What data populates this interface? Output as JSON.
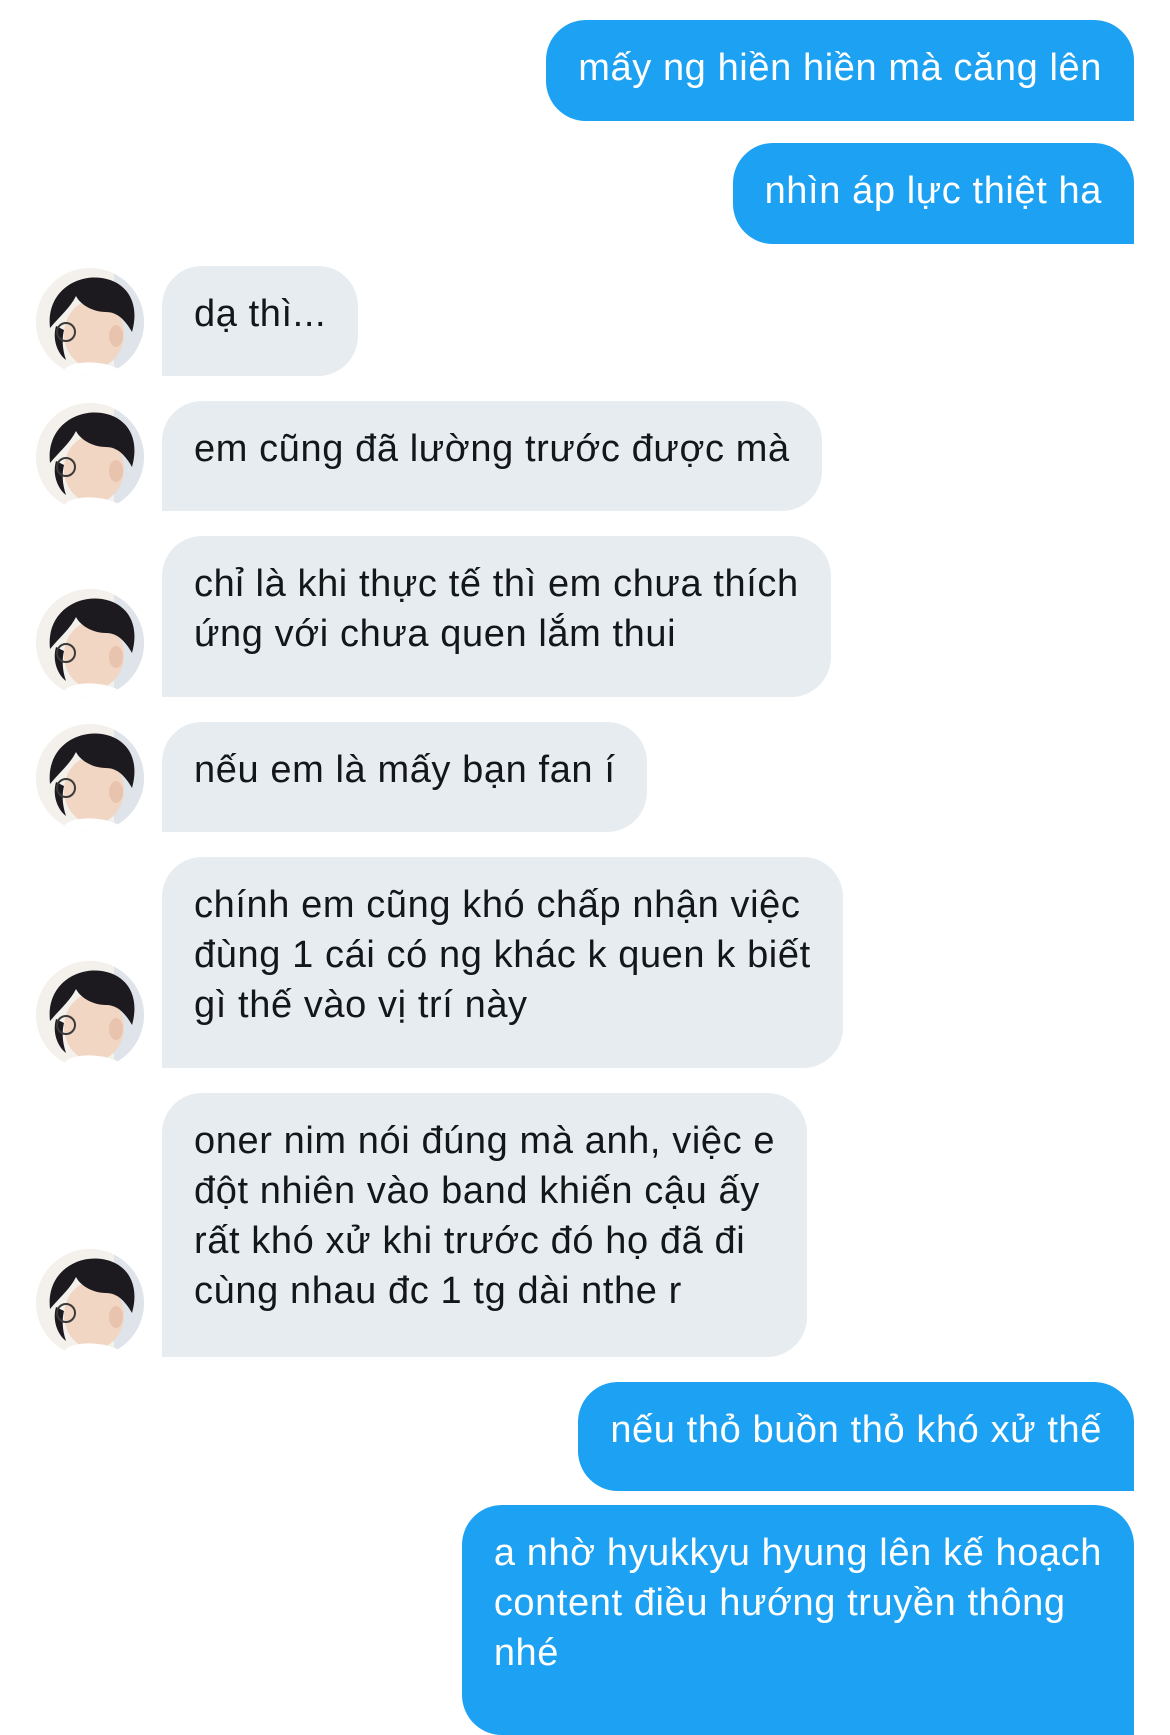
{
  "conversation": {
    "messages": [
      {
        "sender": "me",
        "text": "mấy ng hiền hiền mà căng lên"
      },
      {
        "sender": "me",
        "text": "nhìn áp lực thiệt ha"
      },
      {
        "sender": "them",
        "text": "dạ thì..."
      },
      {
        "sender": "them",
        "text": "em cũng đã lường trước được mà"
      },
      {
        "sender": "them",
        "text": "chỉ là khi thực tế thì em chưa thích\nứng với chưa quen lắm thui"
      },
      {
        "sender": "them",
        "text": "nếu em là mấy bạn fan í"
      },
      {
        "sender": "them",
        "text": "chính em cũng khó chấp nhận việc\nđùng 1 cái có ng khác k quen k biết\ngì thế vào vị trí này"
      },
      {
        "sender": "them",
        "text": "oner nim nói đúng mà anh, việc e\nđột nhiên vào band khiến cậu ấy\nrất khó xử khi trước đó họ đã đi\ncùng nhau đc 1 tg dài nthe r"
      },
      {
        "sender": "me",
        "text": "nếu thỏ buồn thỏ khó xử thế"
      },
      {
        "sender": "me",
        "text": "a nhờ hyukkyu hyung lên kế hoạch\ncontent điều hướng truyền thông\nnhé"
      }
    ]
  },
  "colors": {
    "outgoing_bubble": "#1da1f2",
    "incoming_bubble": "#e6ecf0",
    "incoming_text": "#14171a",
    "outgoing_text": "#ffffff"
  },
  "icons": {
    "avatar": "contact-avatar-photo"
  }
}
